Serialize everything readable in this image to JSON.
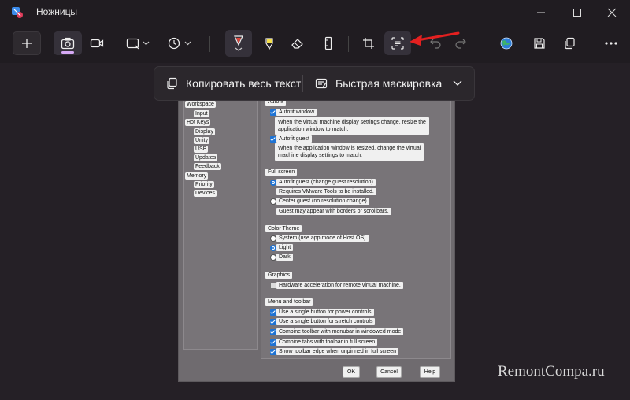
{
  "window": {
    "title": "Ножницы"
  },
  "toolbar": {
    "new": "plus-icon",
    "snip_mode": "camera-icon",
    "record_mode": "video-icon",
    "shape": "rectangle-icon",
    "delay": "clock-icon",
    "accent": "#d6a9f5",
    "pen_color": "#e0453a",
    "highlighter_color": "#f5e04a",
    "arrow_color": "#e32020"
  },
  "floating": {
    "copy_all_text": "Копировать весь текст",
    "quick_redact": "Быстрая маскировка"
  },
  "screenshot": {
    "nav": [
      "Workspace",
      "Input",
      "Hot Keys",
      "Display",
      "Unity",
      "USB",
      "Updates",
      "Feedback",
      "Memory",
      "Priority",
      "Devices"
    ],
    "autofit": {
      "group": "Autofit",
      "window": "Autofit window",
      "window_desc1": "When the virtual machine display settings change, resize the",
      "window_desc2": "application window to match.",
      "guest": "Autofit guest",
      "guest_desc1": "When the application window is resized, change the virtual",
      "guest_desc2": "machine display settings to match."
    },
    "fullscreen": {
      "group": "Full screen",
      "autofit": "Autofit guest (change guest resolution)",
      "tools": "Requires VMware Tools to be installed.",
      "center": "Center guest (no resolution change)",
      "borders": "Guest may appear with borders or scrollbars."
    },
    "theme": {
      "group": "Color Theme",
      "system": "System (use app mode of Host OS)",
      "light": "Light",
      "dark": "Dark"
    },
    "graphics": {
      "group": "Graphics",
      "hw": "Hardware acceleration for remote virtual machine."
    },
    "menu": {
      "group": "Menu and toolbar",
      "o1": "Use a single button for power controls",
      "o2": "Use a single button for stretch controls",
      "o3": "Combine toolbar with menubar in windowed mode",
      "o4": "Combine tabs with toolbar in full screen",
      "o5": "Show toolbar edge when unpinned in full screen"
    },
    "buttons": {
      "ok": "OK",
      "cancel": "Cancel",
      "help": "Help"
    }
  },
  "watermark": "RemontCompa.ru"
}
